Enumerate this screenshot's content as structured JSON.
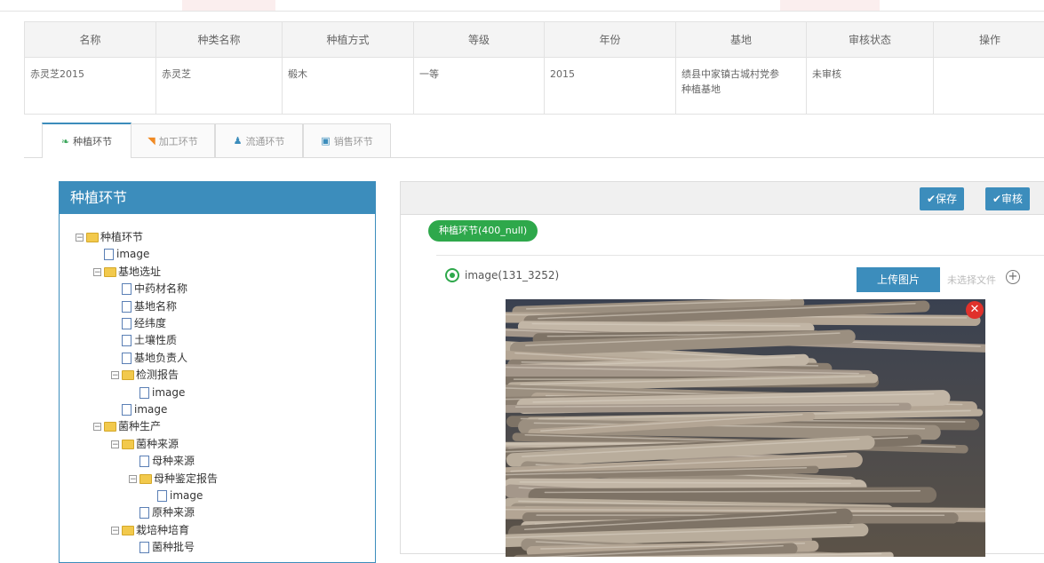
{
  "table": {
    "headers": [
      "名称",
      "种类名称",
      "种植方式",
      "等级",
      "年份",
      "基地",
      "审核状态",
      "操作"
    ],
    "row": [
      "赤灵芝2015",
      "赤灵芝",
      "椴木",
      "一等",
      "2015",
      "绩县中家镇古城村党参种植基地",
      "未审核",
      ""
    ]
  },
  "tabs": [
    {
      "label": "种植环节",
      "icon": "leaf-icon"
    },
    {
      "label": "加工环节",
      "icon": "rss-icon"
    },
    {
      "label": "流通环节",
      "icon": "users-icon"
    },
    {
      "label": "销售环节",
      "icon": "image-icon"
    }
  ],
  "left_panel": {
    "title": "种植环节",
    "tree": [
      {
        "label": "种植环节",
        "type": "folder",
        "depth": 0
      },
      {
        "label": "image",
        "type": "doc",
        "depth": 1
      },
      {
        "label": "基地选址",
        "type": "folder",
        "depth": 1
      },
      {
        "label": "中药材名称",
        "type": "doc",
        "depth": 2
      },
      {
        "label": "基地名称",
        "type": "doc",
        "depth": 2
      },
      {
        "label": "经纬度",
        "type": "doc",
        "depth": 2
      },
      {
        "label": "土壤性质",
        "type": "doc",
        "depth": 2
      },
      {
        "label": "基地负责人",
        "type": "doc",
        "depth": 2
      },
      {
        "label": "检测报告",
        "type": "folder",
        "depth": 2
      },
      {
        "label": "image",
        "type": "doc",
        "depth": 3
      },
      {
        "label": "image",
        "type": "doc",
        "depth": 2
      },
      {
        "label": "菌种生产",
        "type": "folder",
        "depth": 1
      },
      {
        "label": "菌种来源",
        "type": "folder",
        "depth": 2
      },
      {
        "label": "母种来源",
        "type": "doc",
        "depth": 3
      },
      {
        "label": "母种鉴定报告",
        "type": "folder",
        "depth": 3
      },
      {
        "label": "image",
        "type": "doc",
        "depth": 4
      },
      {
        "label": "原种来源",
        "type": "doc",
        "depth": 3
      },
      {
        "label": "栽培种培育",
        "type": "folder",
        "depth": 2
      },
      {
        "label": "菌种批号",
        "type": "doc",
        "depth": 3
      }
    ]
  },
  "right_panel": {
    "save_label": "✔保存",
    "review_label": "✔审核",
    "section_pill": "种植环节(400_null)",
    "image_label": "image(131_3252)",
    "upload_label": "上传图片",
    "no_file_label": "未选择文件",
    "add_icon": "plus-circle-icon",
    "close_icon": "close-icon"
  },
  "colors": {
    "primary": "#3c8dbc",
    "success": "#2ea84b",
    "danger": "#e0312b"
  }
}
